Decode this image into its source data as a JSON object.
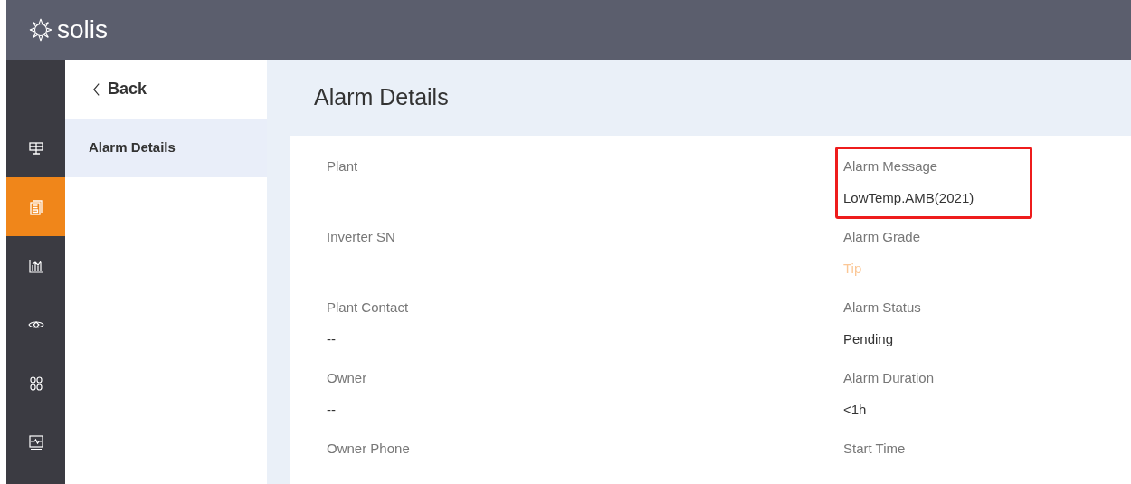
{
  "header": {
    "brand": "solis"
  },
  "rail": [
    {
      "selected": false
    },
    {
      "selected": true
    },
    {
      "selected": false
    },
    {
      "selected": false
    },
    {
      "selected": false
    },
    {
      "selected": false
    }
  ],
  "subnav": {
    "back": "Back",
    "items": [
      {
        "label": "Alarm Details",
        "selected": true
      }
    ]
  },
  "page_title": "Alarm Details",
  "fields": [
    {
      "label": "Plant",
      "highlighted": false
    },
    {
      "label": "Alarm Message",
      "value": "LowTemp.AMB(2021)",
      "highlighted": true
    },
    {
      "label": "Inverter SN",
      "highlighted": false
    },
    {
      "label": "Alarm Grade",
      "value": "Tip",
      "color": "#fbc796",
      "highlighted": false
    },
    {
      "label": "Plant Contact",
      "value": "--",
      "highlighted": false
    },
    {
      "label": "Alarm Status",
      "value": "Pending",
      "highlighted": false
    },
    {
      "label": "Owner",
      "value": "--",
      "highlighted": false
    },
    {
      "label": "Alarm Duration",
      "value": "<1h",
      "highlighted": false
    },
    {
      "label": "Owner Phone",
      "highlighted": false
    },
    {
      "label": "Start Time",
      "highlighted": false
    }
  ]
}
